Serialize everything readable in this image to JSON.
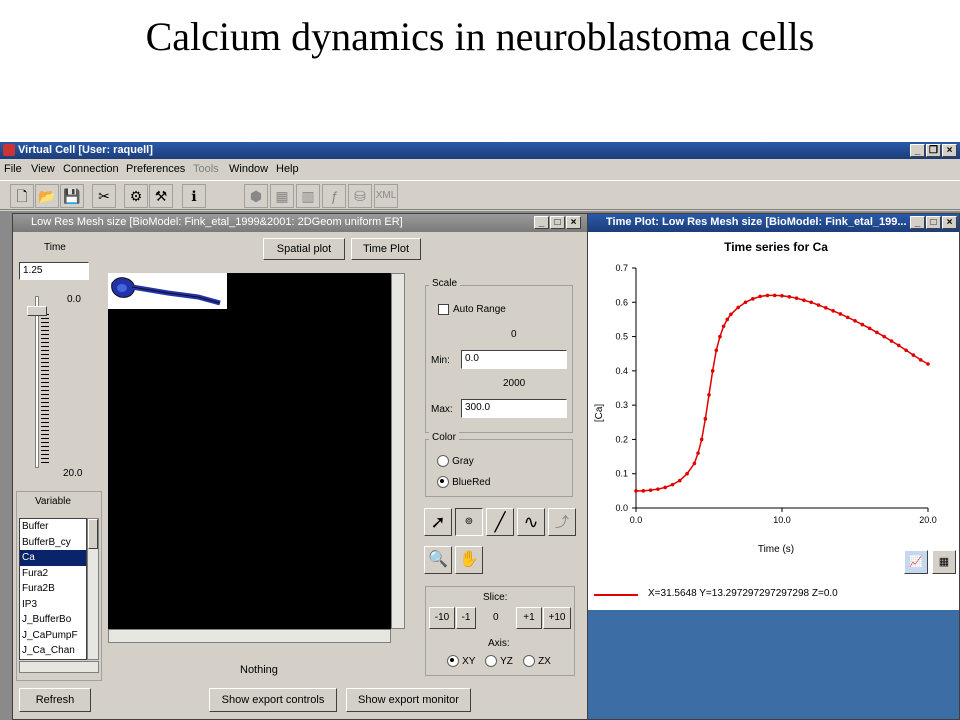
{
  "slide_title": "Calcium dynamics in neuroblastoma cells",
  "app": {
    "title": "Virtual Cell [User: raquell]",
    "menu": [
      "File",
      "View",
      "Connection",
      "Preferences",
      "Tools",
      "Window",
      "Help"
    ],
    "toolbar_icons": [
      "new-icon",
      "open-icon",
      "save-icon",
      "cut-icon",
      "model-icon",
      "tools-icon",
      "info-icon",
      "geometry-icon",
      "mesh-icon",
      "chart-icon",
      "function-icon",
      "database-icon",
      "xml-icon"
    ],
    "toolbar_xml": "XML"
  },
  "left_window": {
    "title": "Low Res Mesh size [BioModel: Fink_etal_1999&2001: 2DGeom uniform ER]",
    "time_label": "Time",
    "time_value": "1.25",
    "slider_min": "0.0",
    "slider_max": "20.0",
    "variable_label": "Variable",
    "variables": [
      "Buffer",
      "BufferB_cy",
      "Ca",
      "Fura2",
      "Fura2B",
      "IP3",
      "J_BufferBo",
      "J_CaPumpF",
      "J_Ca_Chan"
    ],
    "selected_variable": "Ca",
    "refresh_label": "Refresh",
    "spatial_plot_label": "Spatial plot",
    "time_plot_label": "Time Plot",
    "status_text": "Nothing",
    "scale": {
      "label": "Scale",
      "auto_range": "Auto Range",
      "min_hint": "0",
      "min_label": "Min:",
      "min_value": "0.0",
      "max_hint": "2000",
      "max_label": "Max:",
      "max_value": "300.0"
    },
    "color": {
      "label": "Color",
      "options": [
        "Gray",
        "BlueRed"
      ],
      "selected": "BlueRed"
    },
    "slice": {
      "label": "Slice:",
      "buttons_minus": [
        "-10",
        "-1"
      ],
      "value": "0",
      "buttons_plus": [
        "+1",
        "+10"
      ],
      "axis_label": "Axis:",
      "axes": [
        "XY",
        "YZ",
        "ZX"
      ],
      "selected_axis": "XY"
    },
    "show_export_controls": "Show export controls",
    "show_export_monitor": "Show export monitor"
  },
  "right_window": {
    "title": "Time Plot: Low Res Mesh size [BioModel: Fink_etal_199...",
    "status_text": "X=31.5648 Y=13.297297297297298 Z=0.0",
    "line_color": "#e00000"
  },
  "chart_data": {
    "type": "line",
    "title": "Time series for Ca",
    "xlabel": "Time (s)",
    "ylabel": "[Ca]",
    "xlim": [
      0,
      20
    ],
    "ylim": [
      0,
      0.7
    ],
    "xticks": [
      "0.0",
      "10.0",
      "20.0"
    ],
    "yticks": [
      "0.0",
      "0.1",
      "0.2",
      "0.3",
      "0.4",
      "0.5",
      "0.6",
      "0.7"
    ],
    "series": [
      {
        "x": [
          0,
          0.5,
          1,
          1.5,
          2,
          2.5,
          3,
          3.5,
          4,
          4.25,
          4.5,
          4.75,
          5,
          5.25,
          5.5,
          5.75,
          6,
          6.25,
          6.5,
          7,
          7.5,
          8,
          8.5,
          9,
          9.5,
          10,
          10.5,
          11,
          11.5,
          12,
          12.5,
          13,
          13.5,
          14,
          14.5,
          15,
          15.5,
          16,
          16.5,
          17,
          17.5,
          18,
          18.5,
          19,
          19.5,
          20
        ],
        "y": [
          0.05,
          0.05,
          0.052,
          0.055,
          0.06,
          0.068,
          0.08,
          0.1,
          0.13,
          0.16,
          0.2,
          0.26,
          0.33,
          0.4,
          0.46,
          0.5,
          0.53,
          0.55,
          0.565,
          0.585,
          0.6,
          0.61,
          0.617,
          0.62,
          0.62,
          0.619,
          0.616,
          0.612,
          0.606,
          0.6,
          0.592,
          0.584,
          0.575,
          0.566,
          0.556,
          0.546,
          0.535,
          0.524,
          0.512,
          0.5,
          0.487,
          0.474,
          0.46,
          0.446,
          0.432,
          0.42
        ]
      }
    ]
  }
}
